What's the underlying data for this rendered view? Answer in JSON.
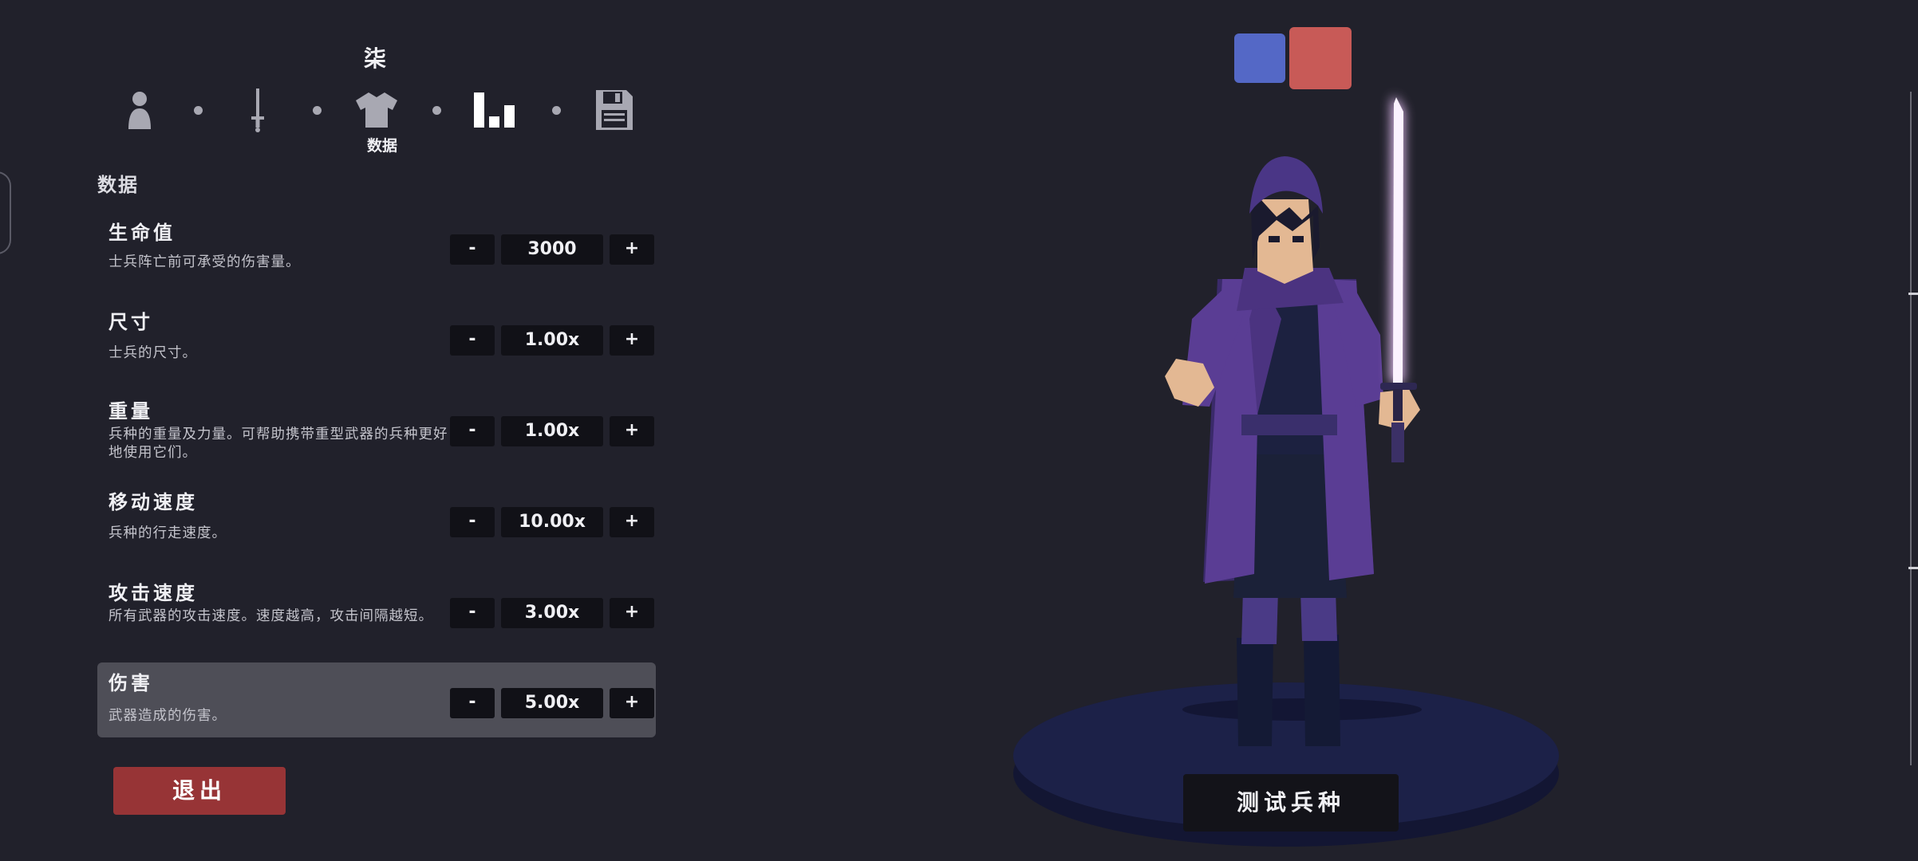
{
  "unit": {
    "name": "柒"
  },
  "nav": {
    "steps": [
      {
        "icon": "person-icon",
        "label": ""
      },
      {
        "icon": "sword-icon",
        "label": ""
      },
      {
        "icon": "shirt-icon",
        "label": ""
      },
      {
        "icon": "bar-chart-icon",
        "label": "数据"
      },
      {
        "icon": "save-icon",
        "label": ""
      }
    ],
    "active_label": "数据"
  },
  "section": {
    "title": "数据"
  },
  "stats": [
    {
      "name": "生命值",
      "desc": "士兵阵亡前可承受的伤害量。",
      "value": "3000",
      "minus": "-",
      "plus": "+"
    },
    {
      "name": "尺寸",
      "desc": "士兵的尺寸。",
      "value": "1.00x",
      "minus": "-",
      "plus": "+"
    },
    {
      "name": "重量",
      "desc": "兵种的重量及力量。可帮助携带重型武器的兵种更好地使用它们。",
      "value": "1.00x",
      "minus": "-",
      "plus": "+"
    },
    {
      "name": "移动速度",
      "desc": "兵种的行走速度。",
      "value": "10.00x",
      "minus": "-",
      "plus": "+"
    },
    {
      "name": "攻击速度",
      "desc": "所有武器的攻击速度。速度越高，攻击间隔越短。",
      "value": "3.00x",
      "minus": "-",
      "plus": "+"
    },
    {
      "name": "伤害",
      "desc": "武器造成的伤害。",
      "value": "5.00x",
      "minus": "-",
      "plus": "+",
      "selected": true
    }
  ],
  "buttons": {
    "exit": "退出",
    "test": "测试兵种"
  },
  "team_colors": {
    "blue": "#5468c6",
    "red": "#c85a57"
  },
  "colors": {
    "background": "#21212b",
    "panel_selected": "#4e4e57",
    "field": "#111117",
    "exit": "#973436",
    "glow": "#f7e9ff",
    "cloak": "#5a3d94"
  }
}
